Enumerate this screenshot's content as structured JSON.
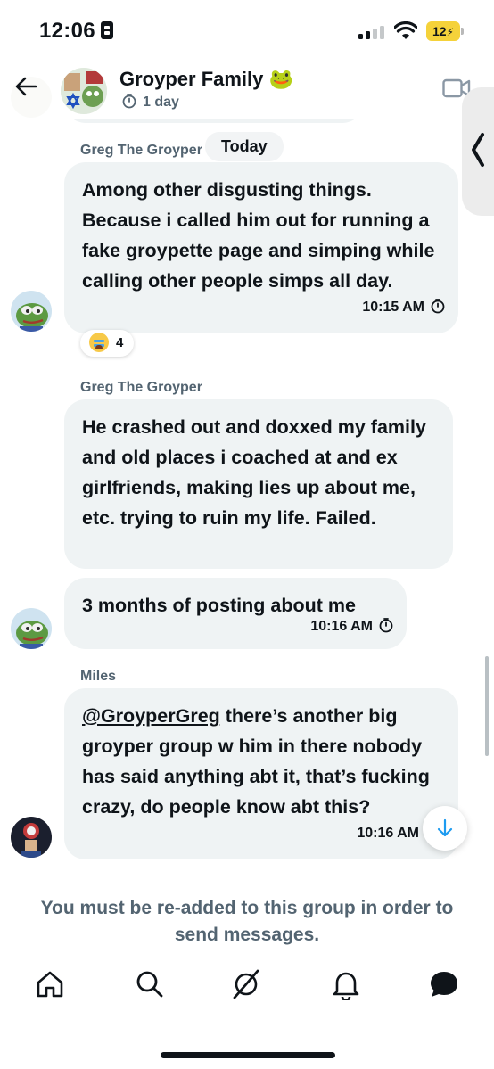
{
  "status_bar": {
    "time": "12:06",
    "battery": "12"
  },
  "header": {
    "group_name": "Groyper Family 🐸",
    "subtitle": "1 day"
  },
  "chat": {
    "today_label": "Today",
    "messages": [
      {
        "sender": "Greg The Groyper",
        "text": "Among other disgusting things. Because i called him out for running a fake groypette page and simping while calling other people simps all day.",
        "time": "10:15 AM",
        "reaction": {
          "emoji": "loudly-crying-face",
          "count": "4"
        }
      },
      {
        "sender": "Greg The Groyper",
        "text": "He crashed out and doxxed my family and old places i coached at and ex girlfriends, making lies up about me, etc. trying to ruin my life. Failed."
      },
      {
        "text": "3 months of posting about me",
        "time": "10:16 AM"
      },
      {
        "sender": "Miles",
        "mention": "@GroyperGreg",
        "text": " there’s another big groyper group w him in there nobody has said anything abt it, that’s fucking crazy, do people know abt this?",
        "time": "10:16 AM"
      }
    ]
  },
  "notice": "You must be re-added to this group in order to send messages.",
  "nav": {
    "items": [
      "home-icon",
      "search-icon",
      "grok-icon",
      "notifications-icon",
      "messages-icon"
    ]
  },
  "colors": {
    "bubble": "#eff3f4",
    "secondary_text": "#536471",
    "accent": "#1d9bf0",
    "battery": "#f5d23a"
  }
}
